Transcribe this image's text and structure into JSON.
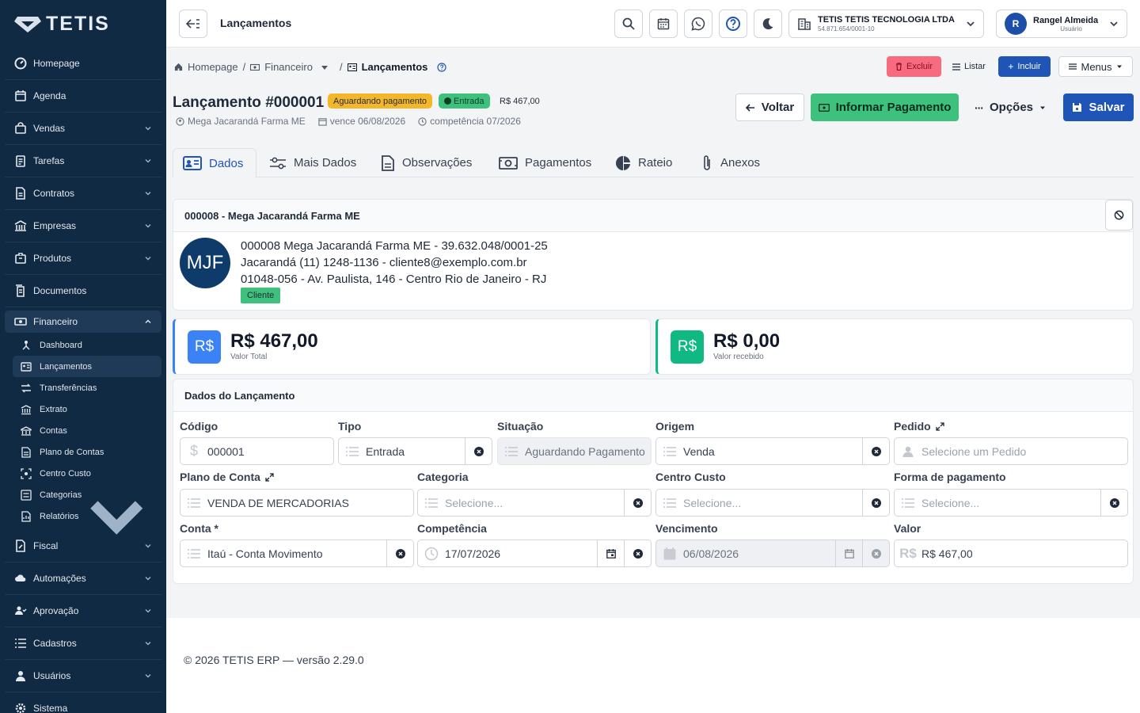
{
  "sidebar": {
    "logo": "TETIS",
    "items": [
      {
        "label": "Homepage",
        "icon": "speedometer-icon"
      },
      {
        "label": "Agenda",
        "icon": "calendar-icon"
      },
      {
        "label": "Vendas",
        "icon": "shopping-bag-icon"
      },
      {
        "label": "Tarefas",
        "icon": "clipboard-icon"
      },
      {
        "label": "Contratos",
        "icon": "file-contract-icon"
      },
      {
        "label": "Empresas",
        "icon": "building-icon"
      },
      {
        "label": "Produtos",
        "icon": "package-icon"
      },
      {
        "label": "Documentos",
        "icon": "documents-icon"
      },
      {
        "label": "Financeiro",
        "icon": "money-icon"
      }
    ],
    "financeiro_sub": [
      {
        "label": "Dashboard"
      },
      {
        "label": "Lançamentos"
      },
      {
        "label": "Transferências"
      },
      {
        "label": "Extrato"
      },
      {
        "label": "Contas"
      },
      {
        "label": "Plano de Contas"
      },
      {
        "label": "Centro Custo"
      },
      {
        "label": "Categorias"
      },
      {
        "label": "Relatórios"
      }
    ],
    "items_after": [
      {
        "label": "Fiscal"
      },
      {
        "label": "Automações"
      },
      {
        "label": "Aprovação"
      },
      {
        "label": "Cadastros"
      },
      {
        "label": "Usuários"
      },
      {
        "label": "Sistema"
      }
    ]
  },
  "header": {
    "title": "Lançamentos",
    "company_name": "TETIS TETIS TECNOLOGIA LTDA",
    "company_cnpj": "54.871.654/0001-10",
    "user_initial": "R",
    "user_name": "Rangel Almeida",
    "user_role": "Usuário"
  },
  "breadcrumb": {
    "home": "Homepage",
    "section": "Financeiro",
    "current": "Lançamentos"
  },
  "toolbar": {
    "delete": "Excluir",
    "list": "Listar",
    "add": "Incluir",
    "menus": "Menus"
  },
  "record": {
    "title": "Lançamento #000001",
    "status_badge": "Aguardando pagamento",
    "type_badge": "Entrada",
    "amount_badge": "R$ 467,00",
    "client": "Mega Jacarandá Farma ME",
    "due": "vence 06/08/2026",
    "competence": "competência 07/2026"
  },
  "actions": {
    "back": "Voltar",
    "pay": "Informar Pagamento",
    "options": "Opções",
    "save": "Salvar"
  },
  "tabs": [
    "Dados",
    "Mais Dados",
    "Observações",
    "Pagamentos",
    "Rateio",
    "Anexos"
  ],
  "client_card": {
    "header": "000008 - Mega Jacarandá Farma ME",
    "initials": "MJF",
    "line1": "000008 Mega Jacarandá Farma ME - 39.632.048/0001-25",
    "line2": "Jacarandá (11) 1248-1136 - cliente8@exemplo.com.br",
    "line3": "01048-056 - Av. Paulista, 146 - Centro Rio de Janeiro - RJ",
    "tag": "Cliente"
  },
  "stats": [
    {
      "icon": "R$",
      "value": "R$ 467,00",
      "label": "Valor Total",
      "color": "#3b82f6"
    },
    {
      "icon": "R$",
      "value": "R$ 0,00",
      "label": "Valor recebido",
      "color": "#10b981"
    }
  ],
  "form": {
    "section_title": "Dados do Lançamento",
    "codigo": {
      "label": "Código",
      "value": "000001"
    },
    "tipo": {
      "label": "Tipo",
      "value": "Entrada"
    },
    "situacao": {
      "label": "Situação",
      "value": "Aguardando Pagamento"
    },
    "origem": {
      "label": "Origem",
      "value": "Venda"
    },
    "pedido": {
      "label": "Pedido",
      "placeholder": "Selecione um Pedido"
    },
    "plano": {
      "label": "Plano de Conta",
      "value": "VENDA DE MERCADORIAS"
    },
    "categoria": {
      "label": "Categoria",
      "placeholder": "Selecione..."
    },
    "centro": {
      "label": "Centro Custo",
      "placeholder": "Selecione..."
    },
    "forma": {
      "label": "Forma de pagamento",
      "placeholder": "Selecione..."
    },
    "conta": {
      "label": "Conta *",
      "value": "Itaú - Conta Movimento"
    },
    "competencia": {
      "label": "Competência",
      "value": "17/07/2026"
    },
    "vencimento": {
      "label": "Vencimento",
      "value": "06/08/2026"
    },
    "valor": {
      "label": "Valor",
      "value": "R$ 467,00"
    }
  },
  "footer": {
    "text": "© 2026 TETIS ERP — versão 2.29.0"
  },
  "colors": {
    "sidebar": "#102a43",
    "primary": "#1f55b6",
    "success": "#3ec17c",
    "warning": "#f5b72a",
    "danger": "#f76a80"
  }
}
